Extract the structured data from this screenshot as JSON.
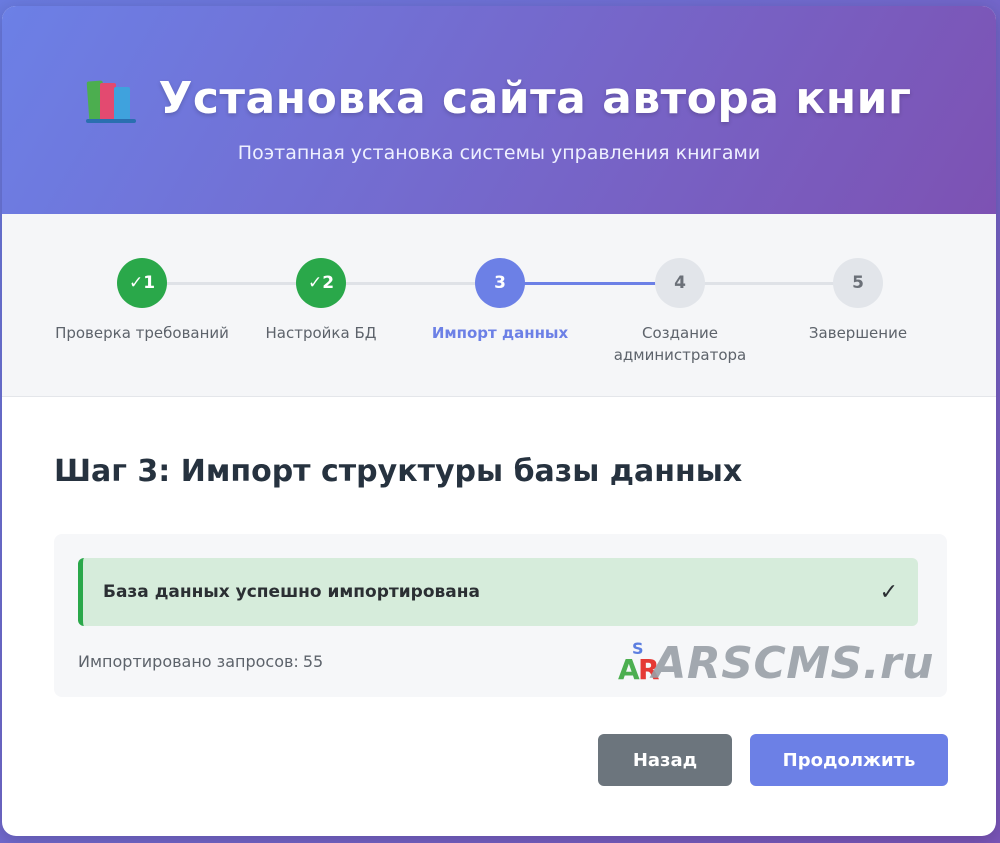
{
  "header": {
    "icon": "books-icon",
    "title": "Установка сайта автора книг",
    "subtitle": "Поэтапная установка системы управления книгами"
  },
  "steps": [
    {
      "badge": "✓1",
      "label": "Проверка требований",
      "state": "done"
    },
    {
      "badge": "✓2",
      "label": "Настройка БД",
      "state": "done"
    },
    {
      "badge": "3",
      "label": "Импорт данных",
      "state": "active"
    },
    {
      "badge": "4",
      "label": "Создание администратора",
      "state": "pending"
    },
    {
      "badge": "5",
      "label": "Завершение",
      "state": "pending"
    }
  ],
  "content": {
    "title": "Шаг 3: Импорт структуры базы данных",
    "alert": {
      "text": "База данных успешно импортирована",
      "icon": "check-icon"
    },
    "imported_label": "Импортировано запросов:",
    "imported_count": "55"
  },
  "watermark": {
    "logo_a": "A",
    "logo_r": "R",
    "logo_s": "S",
    "text": "ARSCMS.ru"
  },
  "buttons": {
    "back": "Назад",
    "next": "Продолжить"
  },
  "colors": {
    "accent": "#6c80e6",
    "success": "#2aa84a",
    "secondary": "#6c757d"
  }
}
